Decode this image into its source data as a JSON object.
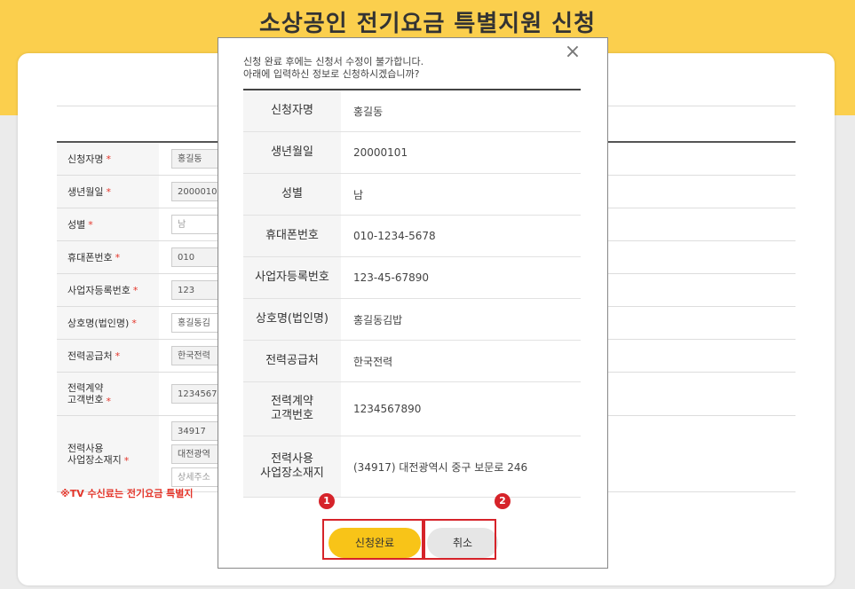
{
  "page": {
    "title": "소상공인 전기요금 특별지원 신청"
  },
  "form": {
    "rows": [
      {
        "label": "신청자명",
        "required": "*",
        "values": [
          "홍길동"
        ]
      },
      {
        "label": "생년월일",
        "required": "*",
        "values": [
          "2000010"
        ]
      },
      {
        "label": "성별",
        "required": "*",
        "values": [
          "남"
        ]
      },
      {
        "label": "휴대폰번호",
        "required": "*",
        "values": [
          "010"
        ]
      },
      {
        "label": "사업자등록번호",
        "required": "*",
        "values": [
          "123"
        ]
      },
      {
        "label": "상호명(법인명)",
        "required": "*",
        "values": [
          "홍길동김"
        ]
      },
      {
        "label": "전력공급처",
        "required": "*",
        "values": [
          "한국전력"
        ]
      },
      {
        "label": "전력계약\n고객번호",
        "required": "*",
        "values": [
          "1234567"
        ]
      },
      {
        "label": "전력사용\n사업장소재지",
        "required": "*",
        "values": [
          "34917",
          "대전광역",
          "상세주소"
        ]
      }
    ],
    "notice": "※TV 수신료는 전기요금 특별지"
  },
  "modal": {
    "message_line1": "신청 완료 후에는 신청서 수정이 불가합니다.",
    "message_line2": "아래에 입력하신 정보로 신청하시겠습니까?",
    "close_glyph": "×",
    "rows": [
      {
        "label": "신청자명",
        "value": "홍길동"
      },
      {
        "label": "생년월일",
        "value": "20000101"
      },
      {
        "label": "성별",
        "value": "남"
      },
      {
        "label": "휴대폰번호",
        "value": "010-1234-5678"
      },
      {
        "label": "사업자등록번호",
        "value": "123-45-67890"
      },
      {
        "label": "상호명(법인명)",
        "value": "홍길동김밥"
      },
      {
        "label": "전력공급처",
        "value": "한국전력"
      },
      {
        "label": "전력계약\n고객번호",
        "value": "1234567890"
      },
      {
        "label": "전력사용\n사업장소재지",
        "value": "(34917) 대전광역시 중구 보문로 246"
      }
    ],
    "confirm_label": "신청완료",
    "cancel_label": "취소",
    "step1": "1",
    "step2": "2"
  },
  "colors": {
    "band": "#fbcf4d",
    "accent": "#f8c418",
    "highlight": "#d6232a",
    "required": "#e4352a"
  }
}
